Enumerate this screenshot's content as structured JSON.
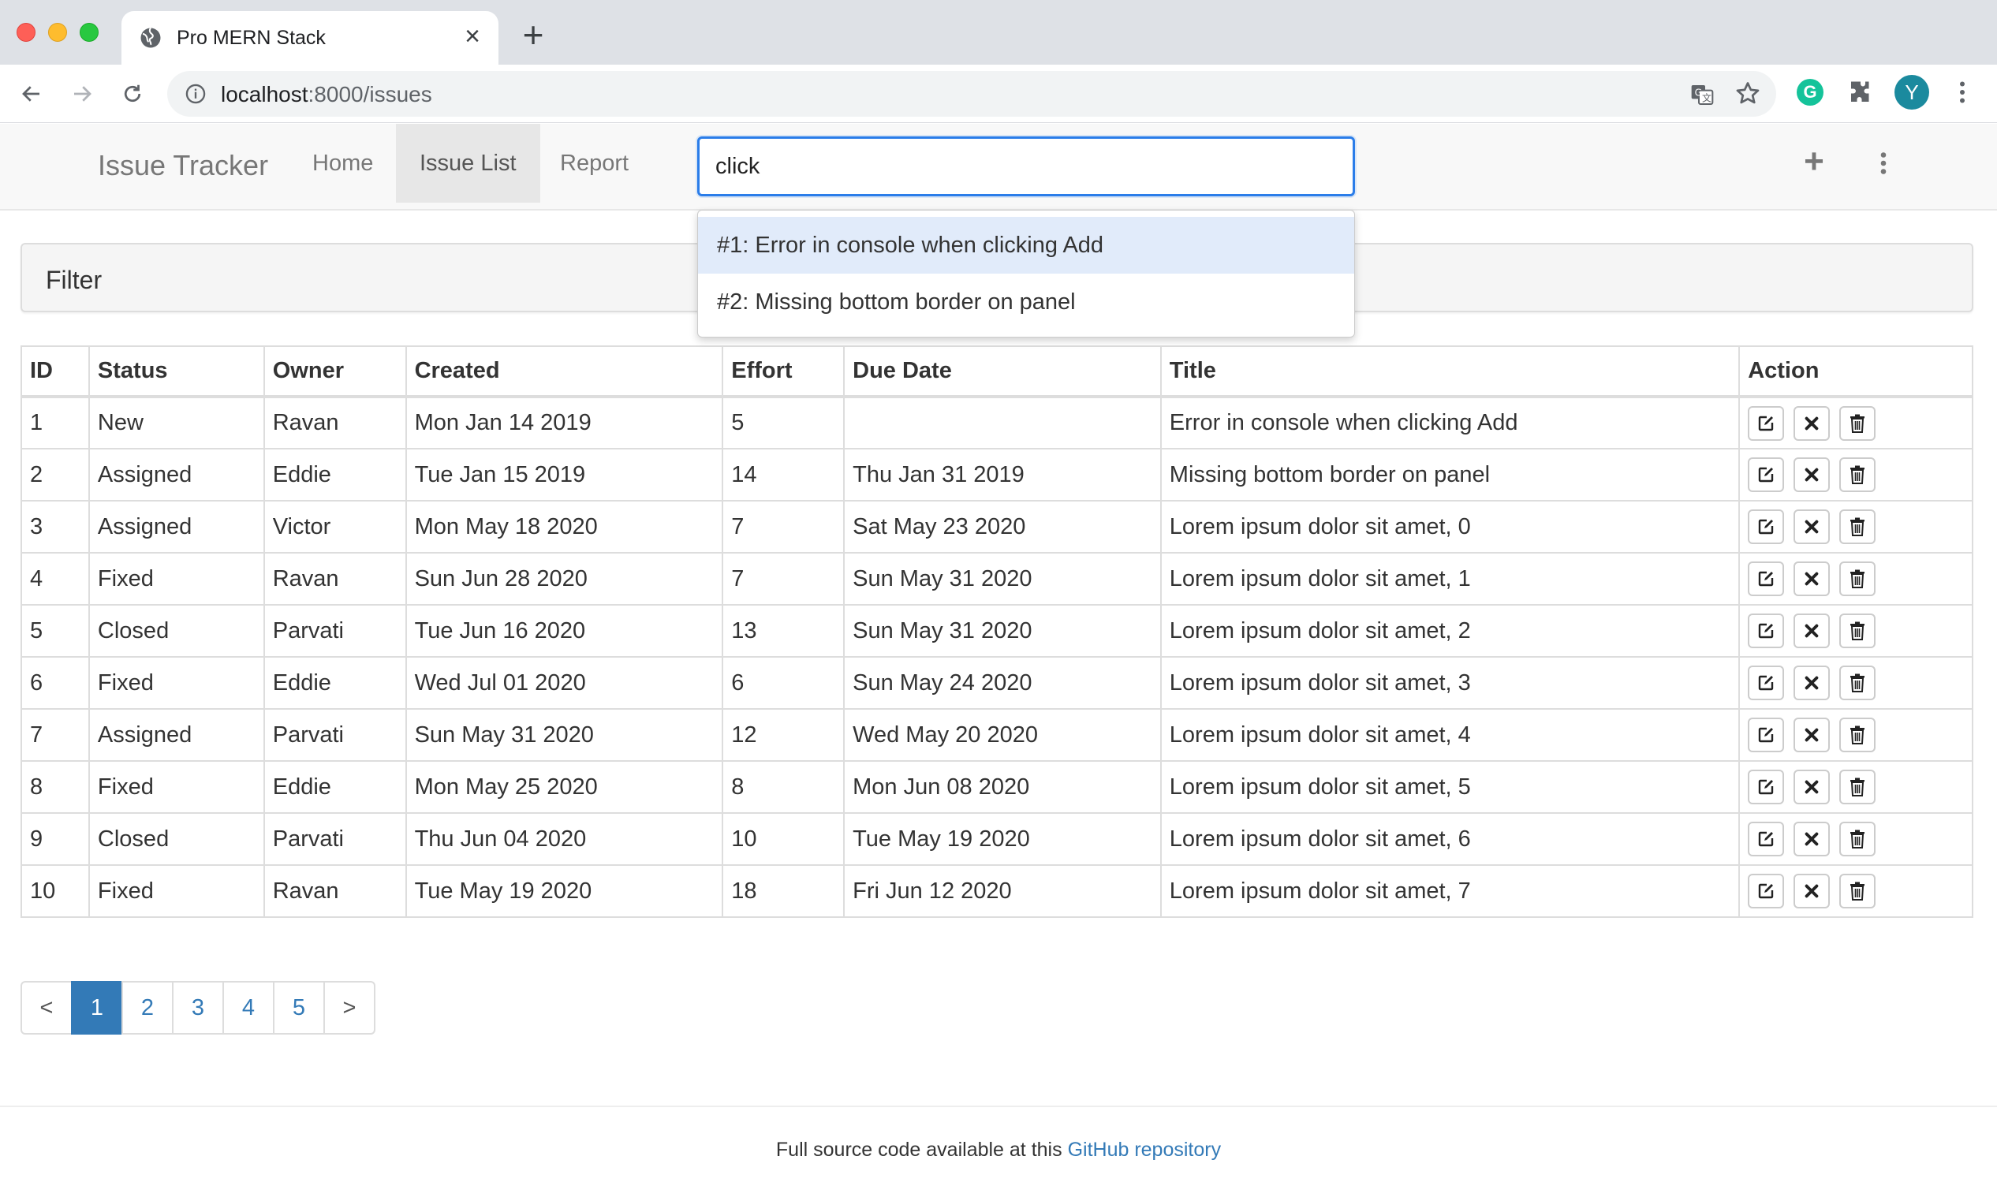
{
  "browser": {
    "tab_title": "Pro MERN Stack",
    "tab_close": "×",
    "new_tab": "+",
    "url_host": "localhost",
    "url_rest": ":8000/issues",
    "profile_initial": "Y",
    "extension_initial": "G"
  },
  "navbar": {
    "brand": "Issue Tracker",
    "links": [
      "Home",
      "Issue List",
      "Report"
    ],
    "active_link": "Issue List",
    "search_value": "click",
    "add_icon": "+"
  },
  "suggestions": [
    "#1: Error in console when clicking Add",
    "#2: Missing bottom border on panel"
  ],
  "filter": {
    "title": "Filter"
  },
  "table": {
    "columns": [
      "ID",
      "Status",
      "Owner",
      "Created",
      "Effort",
      "Due Date",
      "Title",
      "Action"
    ],
    "rows": [
      [
        "1",
        "New",
        "Ravan",
        "Mon Jan 14 2019",
        "5",
        "",
        "Error in console when clicking Add"
      ],
      [
        "2",
        "Assigned",
        "Eddie",
        "Tue Jan 15 2019",
        "14",
        "Thu Jan 31 2019",
        "Missing bottom border on panel"
      ],
      [
        "3",
        "Assigned",
        "Victor",
        "Mon May 18 2020",
        "7",
        "Sat May 23 2020",
        "Lorem ipsum dolor sit amet, 0"
      ],
      [
        "4",
        "Fixed",
        "Ravan",
        "Sun Jun 28 2020",
        "7",
        "Sun May 31 2020",
        "Lorem ipsum dolor sit amet, 1"
      ],
      [
        "5",
        "Closed",
        "Parvati",
        "Tue Jun 16 2020",
        "13",
        "Sun May 31 2020",
        "Lorem ipsum dolor sit amet, 2"
      ],
      [
        "6",
        "Fixed",
        "Eddie",
        "Wed Jul 01 2020",
        "6",
        "Sun May 24 2020",
        "Lorem ipsum dolor sit amet, 3"
      ],
      [
        "7",
        "Assigned",
        "Parvati",
        "Sun May 31 2020",
        "12",
        "Wed May 20 2020",
        "Lorem ipsum dolor sit amet, 4"
      ],
      [
        "8",
        "Fixed",
        "Eddie",
        "Mon May 25 2020",
        "8",
        "Mon Jun 08 2020",
        "Lorem ipsum dolor sit amet, 5"
      ],
      [
        "9",
        "Closed",
        "Parvati",
        "Thu Jun 04 2020",
        "10",
        "Tue May 19 2020",
        "Lorem ipsum dolor sit amet, 6"
      ],
      [
        "10",
        "Fixed",
        "Ravan",
        "Tue May 19 2020",
        "18",
        "Fri Jun 12 2020",
        "Lorem ipsum dolor sit amet, 7"
      ]
    ],
    "action_icons": [
      "edit-icon",
      "close-icon",
      "trash-icon"
    ]
  },
  "pagination": {
    "prev": "<",
    "pages": [
      "1",
      "2",
      "3",
      "4",
      "5"
    ],
    "next": ">",
    "current": "1"
  },
  "footer": {
    "text": "Full source code available at this ",
    "link_text": "GitHub repository"
  },
  "colors": {
    "accent": "#337ab7",
    "focus": "#2b7de9",
    "suggestion_highlight": "#e1ebfa"
  }
}
